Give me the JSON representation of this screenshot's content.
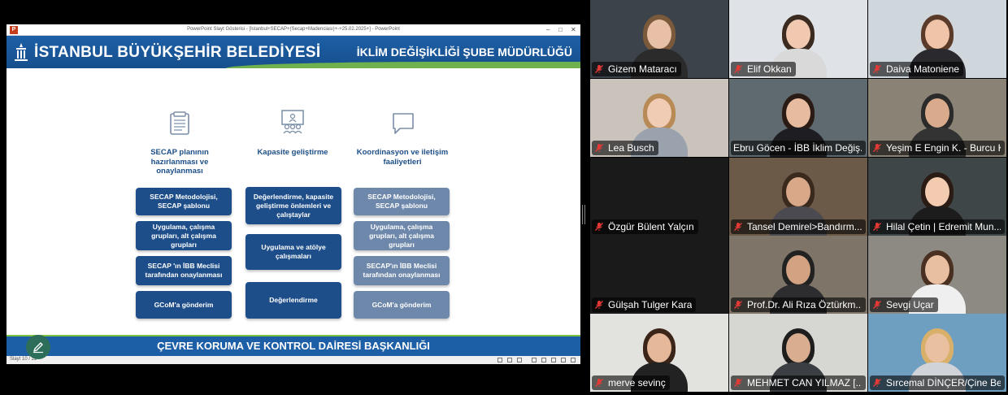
{
  "share": {
    "window_title": "PowerPoint Slayt Gösterisi - [İstanbul+SECAP+(Secap+Madenciası)+-+25.02.2025+] - PowerPoint",
    "app_badge": "P",
    "slide_indicator": "Slayt 10 / 22",
    "header": {
      "org_name": "İSTANBUL BÜYÜKŞEHİR BELEDİYESİ",
      "dept_name": "İKLİM DEĞİŞİKLİĞİ ŞUBE MÜDÜRLÜĞÜ"
    },
    "columns": [
      {
        "icon": "document-icon",
        "title": "SECAP planının hazırlanması ve onaylanması",
        "boxes": [
          "SECAP Metodolojisi, SECAP şablonu",
          "Uygulama, çalışma grupları, alt çalışma grupları",
          "SECAP 'ın İBB Meclisi tarafından onaylanması",
          "GCoM'a gönderim"
        ]
      },
      {
        "icon": "presentation-icon",
        "title": "Kapasite geliştirme",
        "boxes": [
          "Değerlendirme, kapasite geliştirme önlemleri ve çalıştaylar",
          "Uygulama ve atölye çalışmaları",
          "Değerlendirme"
        ]
      },
      {
        "icon": "speech-bubble-icon",
        "title": "Koordinasyon ve iletişim faaliyetleri",
        "boxes": [
          "SECAP Metodolojisi, SECAP şablonu",
          "Uygulama, çalışma grupları, alt çalışma grupları",
          "SECAP'ın İBB Meclisi tarafından onaylanması",
          "GCoM'a gönderim"
        ]
      }
    ],
    "footer_text": "ÇEVRE KORUMA VE KONTROL DAİRESİ BAŞKANLIĞI"
  },
  "participants": [
    {
      "name": "Gizem Mataracı",
      "muted": true
    },
    {
      "name": "Elif Okkan",
      "muted": true
    },
    {
      "name": "Daiva Matoniene",
      "muted": true
    },
    {
      "name": "Lea Busch",
      "muted": true
    },
    {
      "name": "Ebru Göcen - İBB İklim Değiş...",
      "muted": false,
      "speaking": true
    },
    {
      "name": "Yeşim E Engin K. - Burcu K.",
      "muted": true
    },
    {
      "name": "Özgür Bülent Yalçın",
      "muted": true
    },
    {
      "name": "Tansel Demirel>Bandırm...",
      "muted": true
    },
    {
      "name": "Hilal Çetin | Edremit Mun...",
      "muted": true
    },
    {
      "name": "Gülşah Tulger Kara",
      "muted": true
    },
    {
      "name": "Prof.Dr. Ali Rıza Öztürkm...",
      "muted": true
    },
    {
      "name": "Sevgi Uçar",
      "muted": true
    },
    {
      "name": "merve sevinç",
      "muted": true
    },
    {
      "name": "MEHMET CAN YILMAZ [...",
      "muted": true
    },
    {
      "name": "Sırcemal DİNÇER/Çine Be...",
      "muted": true
    }
  ],
  "colors": {
    "banner_blue": "#1d5fa6",
    "box_dark": "#1d4e8a",
    "box_grey": "#6e88ac",
    "active_speaker": "#3ccf6e",
    "muted_red": "#e53935"
  }
}
